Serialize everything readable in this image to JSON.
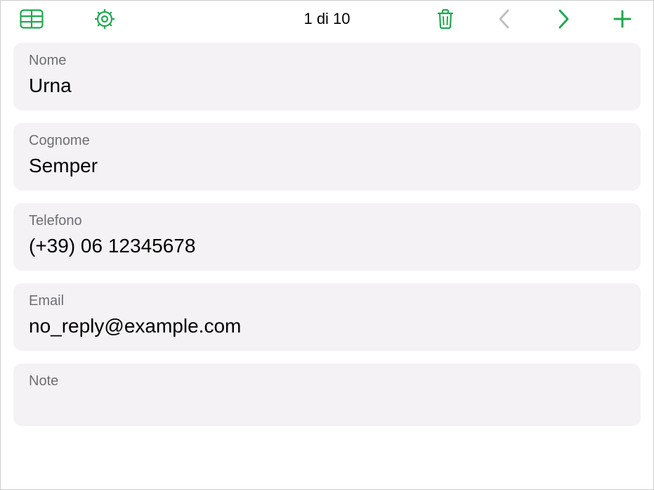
{
  "toolbar": {
    "position_text": "1 di 10",
    "icons": {
      "table": "table-icon",
      "settings": "gear-icon",
      "delete": "trash-icon",
      "prev": "chevron-left-icon",
      "next": "chevron-right-icon",
      "add": "plus-icon"
    }
  },
  "fields": [
    {
      "label": "Nome",
      "value": "Urna"
    },
    {
      "label": "Cognome",
      "value": "Semper"
    },
    {
      "label": "Telefono",
      "value": "(+39) 06 12345678"
    },
    {
      "label": "Email",
      "value": "no_reply@example.com"
    },
    {
      "label": "Note",
      "value": ""
    }
  ],
  "colors": {
    "accent": "#1fa94f",
    "card_bg": "#f4f2f5",
    "label_muted": "#6e6e73",
    "disabled": "#c0c0c0"
  }
}
